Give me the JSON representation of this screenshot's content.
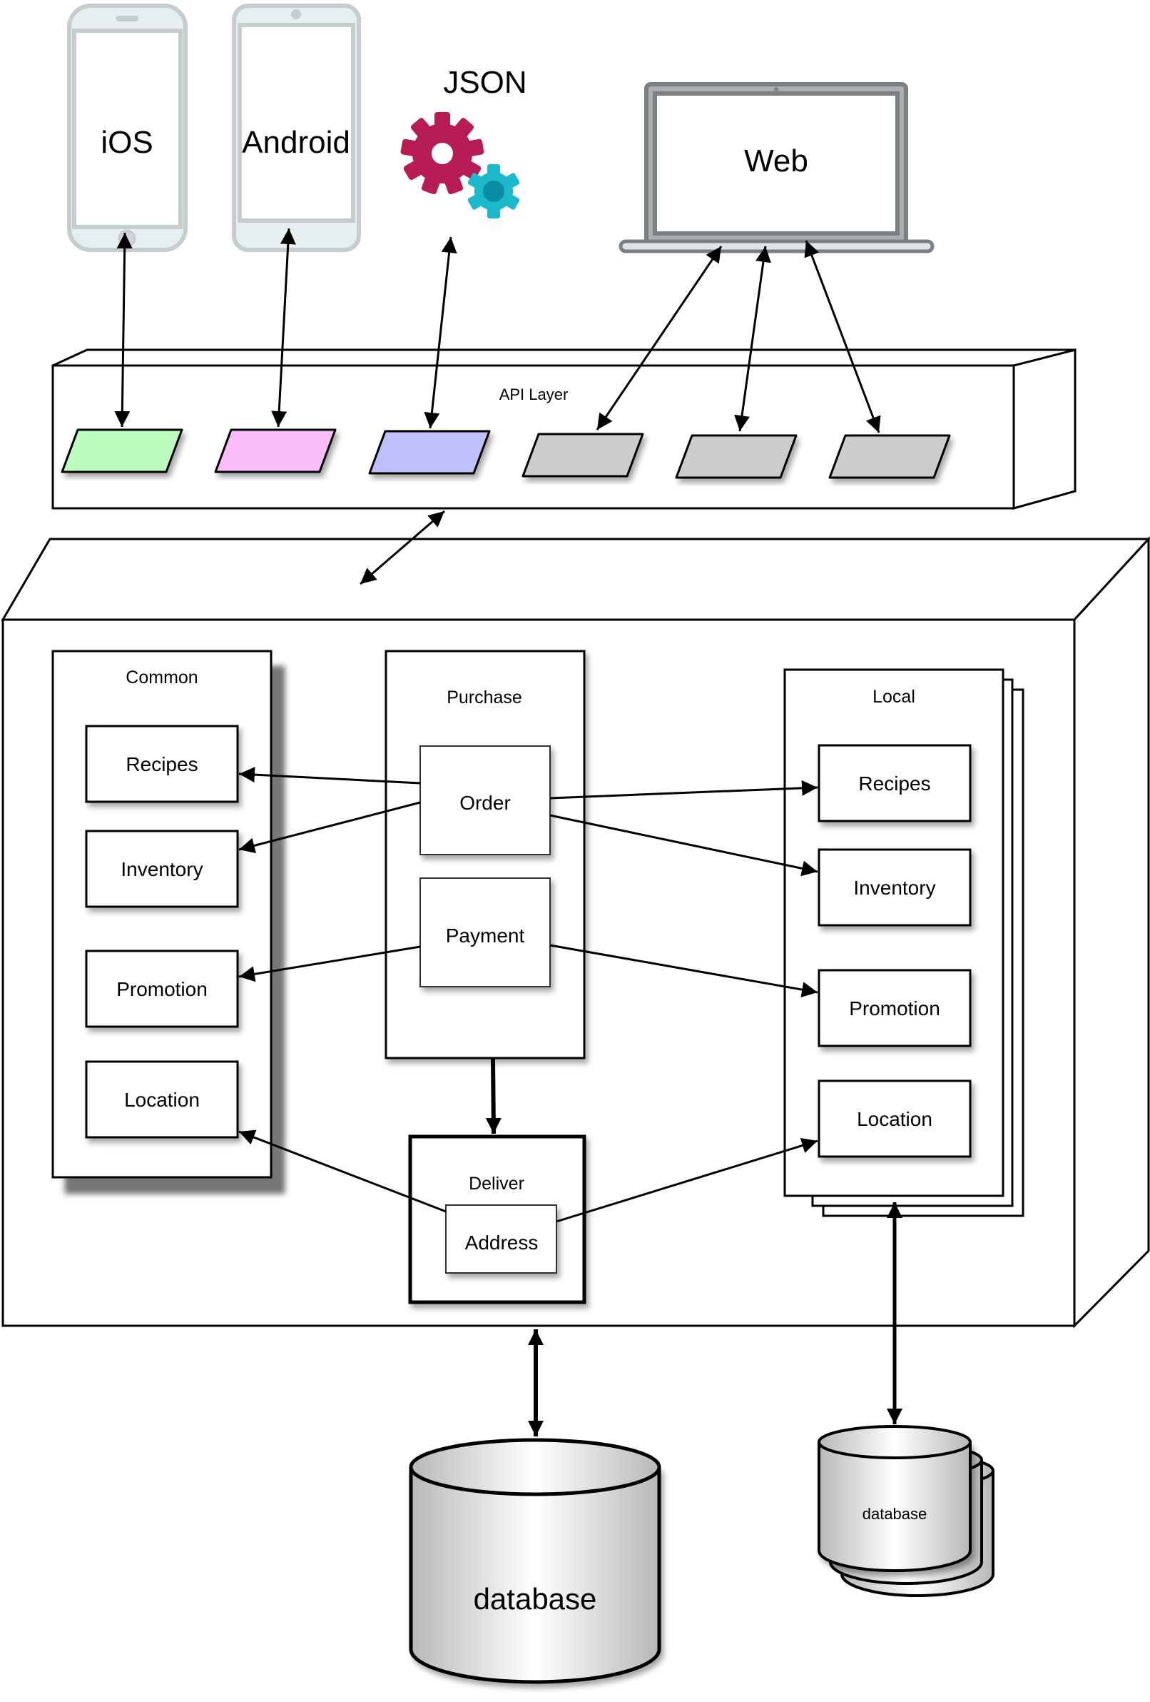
{
  "clients": {
    "ios": {
      "label": "iOS",
      "icon": "smartphone-ios-icon"
    },
    "android": {
      "label": "Android",
      "icon": "smartphone-android-icon"
    },
    "json": {
      "label": "JSON",
      "icon": "gears-icon"
    },
    "web": {
      "label": "Web",
      "icon": "laptop-icon"
    }
  },
  "api_layer": {
    "label": "API Layer",
    "endpoints": [
      {
        "color": "#bdfcc0",
        "target": "iOS"
      },
      {
        "color": "#fbbdfa",
        "target": "Android"
      },
      {
        "color": "#bfbffd",
        "target": "JSON"
      },
      {
        "color": "#cccccc",
        "target": "Web"
      },
      {
        "color": "#cccccc",
        "target": "Web"
      },
      {
        "color": "#cccccc",
        "target": "Web"
      }
    ]
  },
  "common": {
    "label": "Common",
    "items": [
      "Recipes",
      "Inventory",
      "Promotion",
      "Location"
    ]
  },
  "purchase": {
    "label": "Purchase",
    "items": [
      "Order",
      "Payment"
    ]
  },
  "deliver": {
    "label": "Deliver",
    "items": [
      "Address"
    ]
  },
  "local": {
    "label": "Local",
    "items": [
      "Recipes",
      "Inventory",
      "Promotion",
      "Location"
    ]
  },
  "databases": {
    "central": {
      "label": "database"
    },
    "local": {
      "label": "database"
    }
  },
  "connections": [
    {
      "from": "Order",
      "to": "Common.Recipes"
    },
    {
      "from": "Order",
      "to": "Common.Inventory"
    },
    {
      "from": "Payment",
      "to": "Common.Promotion"
    },
    {
      "from": "Address",
      "to": "Common.Location"
    },
    {
      "from": "Order",
      "to": "Local.Recipes"
    },
    {
      "from": "Order",
      "to": "Local.Inventory"
    },
    {
      "from": "Payment",
      "to": "Local.Promotion"
    },
    {
      "from": "Address",
      "to": "Local.Location"
    },
    {
      "from": "Purchase",
      "to": "Deliver"
    }
  ],
  "colors": {
    "gear_primary": "#b81c55",
    "gear_secondary": "#1cb8cc",
    "device_outline": "#c5cdce",
    "laptop_outline": "#7b7f81"
  }
}
